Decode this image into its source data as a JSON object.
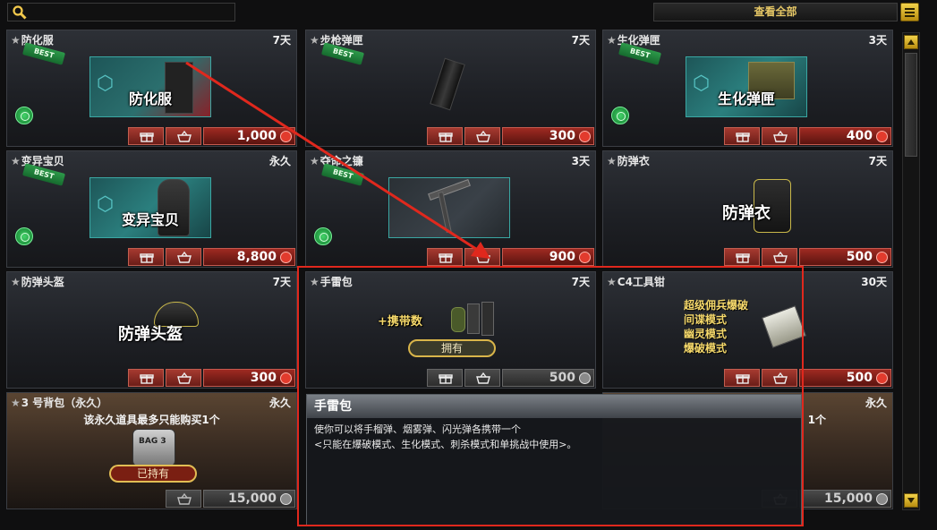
{
  "top": {
    "search_placeholder": "",
    "view_all": "查看全部"
  },
  "items": [
    {
      "name": "防化服",
      "days": "7天",
      "best": "BEST",
      "art_label": "防化服",
      "price": "1,000",
      "mode": true
    },
    {
      "name": "步枪弹匣",
      "days": "7天",
      "best": "BEST",
      "art_label": "",
      "price": "300",
      "mode": false
    },
    {
      "name": "生化弹匣",
      "days": "3天",
      "best": "BEST",
      "art_label": "生化弹匣",
      "price": "400",
      "mode": true
    },
    {
      "name": "变异宝贝",
      "days": "永久",
      "best": "BEST",
      "art_label": "变异宝贝",
      "price": "8,800",
      "mode": true
    },
    {
      "name": "夺命之镰",
      "days": "3天",
      "best": "BEST",
      "art_label": "",
      "price": "900",
      "mode": true
    },
    {
      "name": "防弹衣",
      "days": "7天",
      "best": "",
      "art_label": "防弹衣",
      "price": "500",
      "mode": false
    },
    {
      "name": "防弹头盔",
      "days": "7天",
      "best": "",
      "art_label": "防弹头盔",
      "price": "300",
      "mode": false
    },
    {
      "name": "手雷包",
      "days": "7天",
      "best": "",
      "art_label": "+携带数",
      "owned": "拥有",
      "price": "500",
      "mode": false
    },
    {
      "name": "C4工具钳",
      "days": "30天",
      "best": "",
      "art_lines": [
        "超级佣兵爆破",
        "间谍模式",
        "幽灵模式",
        "爆破模式"
      ],
      "price": "500",
      "mode": false
    },
    {
      "name": "3 号背包（永久）",
      "days": "永久",
      "note": "该永久道具最多只能购买1个",
      "owned": "已持有",
      "art_label": "BAG 3",
      "price": "15,000"
    },
    {
      "name": "",
      "days": "永久",
      "note": "1个",
      "price": "15,000"
    }
  ],
  "tooltip": {
    "title": "手雷包",
    "line1": "使你可以将手榴弹、烟雾弹、闪光弹各携带一个",
    "line2": "<只能在爆破模式、生化模式、刺杀模式和单挑战中使用>。"
  },
  "colors": {
    "accent_gold": "#e6c766",
    "highlight_red": "#e0281d",
    "price_red": "#9f2a22"
  }
}
